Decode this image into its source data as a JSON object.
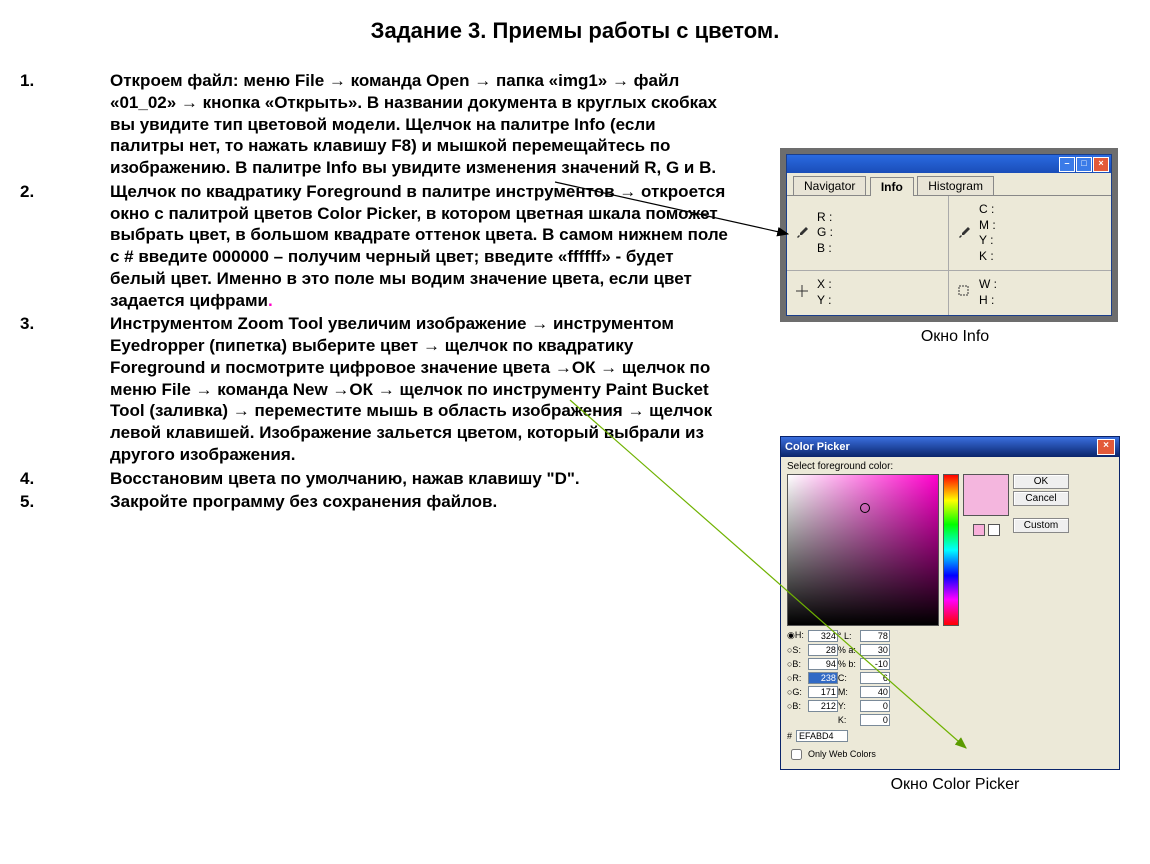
{
  "title": "Задание 3.  Приемы работы с цветом.",
  "steps": [
    "Откроем файл: меню File → команда Open → папка «img1» → файл «01_02» → кнопка «Открыть».  В названии документа в круглых скобках вы увидите тип цветовой модели. Щелчок на палитре Info (если палитры нет, то нажать клавишу F8) и мышкой перемещайтесь по изображению. В палитре Info вы увидите изменения значений R, G  и B.",
    "Щелчок по квадратику Foreground в палитре инструментов → откроется окно с палитрой цветов Color Picker, в котором цветная шкала поможет выбрать цвет, в большом квадрате оттенок цвета.   В самом нижнем поле с # введите 000000 – получим черный цвет; введите «ffffff» - будет белый цвет. Именно в это поле мы водим значение цвета, если цвет задается цифрами",
    "Инструментом Zoom Tool увеличим изображение → инструментом Eyedropper (пипетка) выберите цвет → щелчок по квадратику Foreground и посмотрите цифровое значение цвета →ОК → щелчок по меню File → команда New →ОК → щелчок по инструменту Paint Bucket Tool (заливка) → переместите мышь в область изображения → щелчок левой клавишей. Изображение зальется цветом, который выбрали из другого изображения.",
    "Восстановим цвета по умолчанию, нажав клавишу \"D\".",
    "Закройте программу без сохранения файлов."
  ],
  "period": ".",
  "captions": {
    "info": "Окно Info",
    "picker": "Окно Color Picker"
  },
  "info_panel": {
    "tabs": [
      "Navigator",
      "Info",
      "Histogram"
    ],
    "rgb": [
      "R :",
      "G :",
      "B :"
    ],
    "cmyk": [
      "C :",
      "M :",
      "Y :",
      "K :"
    ],
    "xy": [
      "X :",
      "Y :"
    ],
    "wh": [
      "W :",
      "H :"
    ]
  },
  "picker": {
    "title": "Color Picker",
    "label": "Select foreground color:",
    "buttons": {
      "ok": "OK",
      "cancel": "Cancel",
      "custom": "Custom"
    },
    "fields": {
      "H": "324",
      "S": "28",
      "Bv": "94",
      "L": "78",
      "a": "30",
      "b": "-10",
      "R": "238",
      "G": "171",
      "Bb": "212",
      "C": "6",
      "M": "40",
      "Y": "0",
      "K": "0"
    },
    "deg": "°",
    "pct": "%",
    "hex_prefix": "#",
    "hex": "EFABD4",
    "only_web": "Only Web Colors"
  }
}
